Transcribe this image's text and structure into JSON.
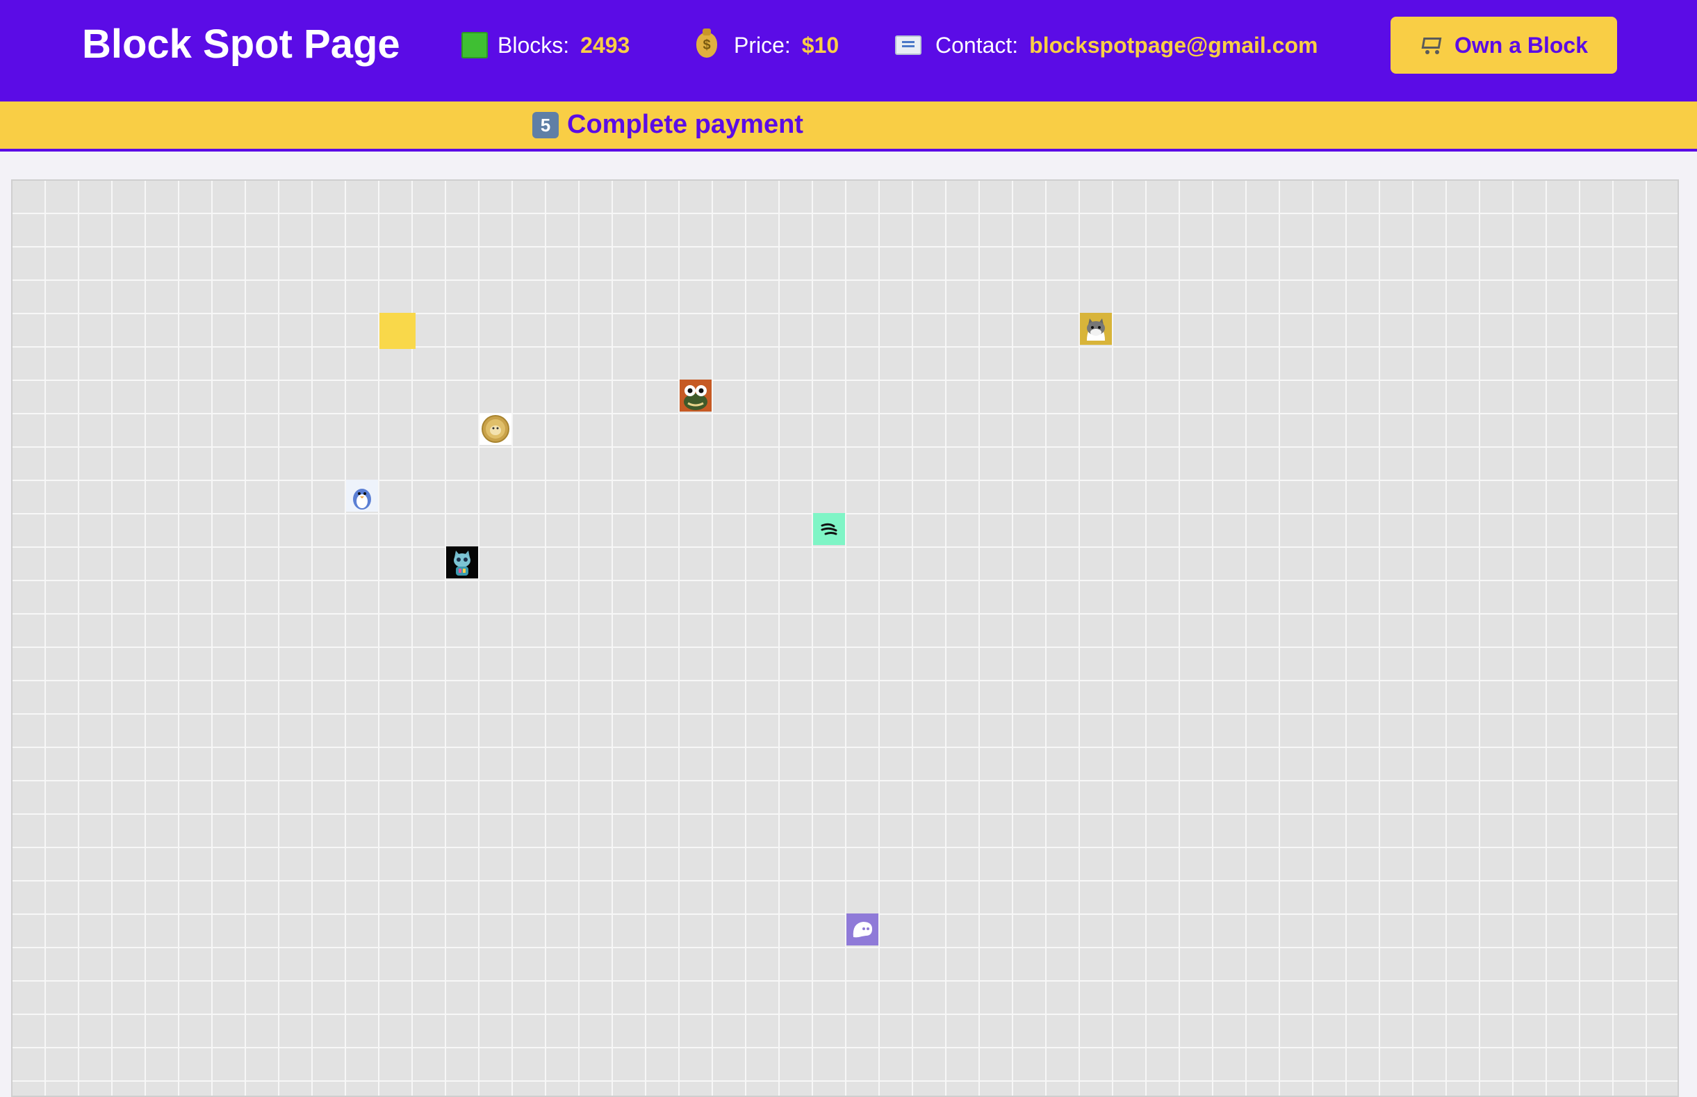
{
  "header": {
    "title": "Block Spot Page",
    "blocks_label": "Blocks:",
    "blocks_value": "2493",
    "price_label": "Price:",
    "price_value": "$10",
    "contact_label": "Contact:",
    "contact_value": "blockspotpage@gmail.com",
    "cta_label": "Own a Block",
    "icons": [
      "green-square-icon",
      "money-bag-icon",
      "envelope-icon",
      "shopping-cart-icon"
    ]
  },
  "banner": {
    "step_number": "5",
    "text": "Complete payment"
  },
  "grid": {
    "blocks": [
      {
        "name": "block-yellow-placeholder",
        "icon": "yellow-square-icon"
      },
      {
        "name": "block-cat",
        "icon": "cat-icon"
      },
      {
        "name": "block-frog",
        "icon": "frog-icon"
      },
      {
        "name": "block-doge-coin",
        "icon": "doge-coin-icon"
      },
      {
        "name": "block-penguin",
        "icon": "penguin-icon"
      },
      {
        "name": "block-wave-logo",
        "icon": "wave-logo-icon"
      },
      {
        "name": "block-robot-cat",
        "icon": "robot-cat-icon"
      },
      {
        "name": "block-ghost",
        "icon": "ghost-icon"
      }
    ]
  },
  "colors": {
    "brand_purple": "#5b0ce6",
    "accent_yellow": "#f9ce45",
    "grid_cell": "#e2e2e2",
    "grid_line": "#f7f7f7"
  }
}
